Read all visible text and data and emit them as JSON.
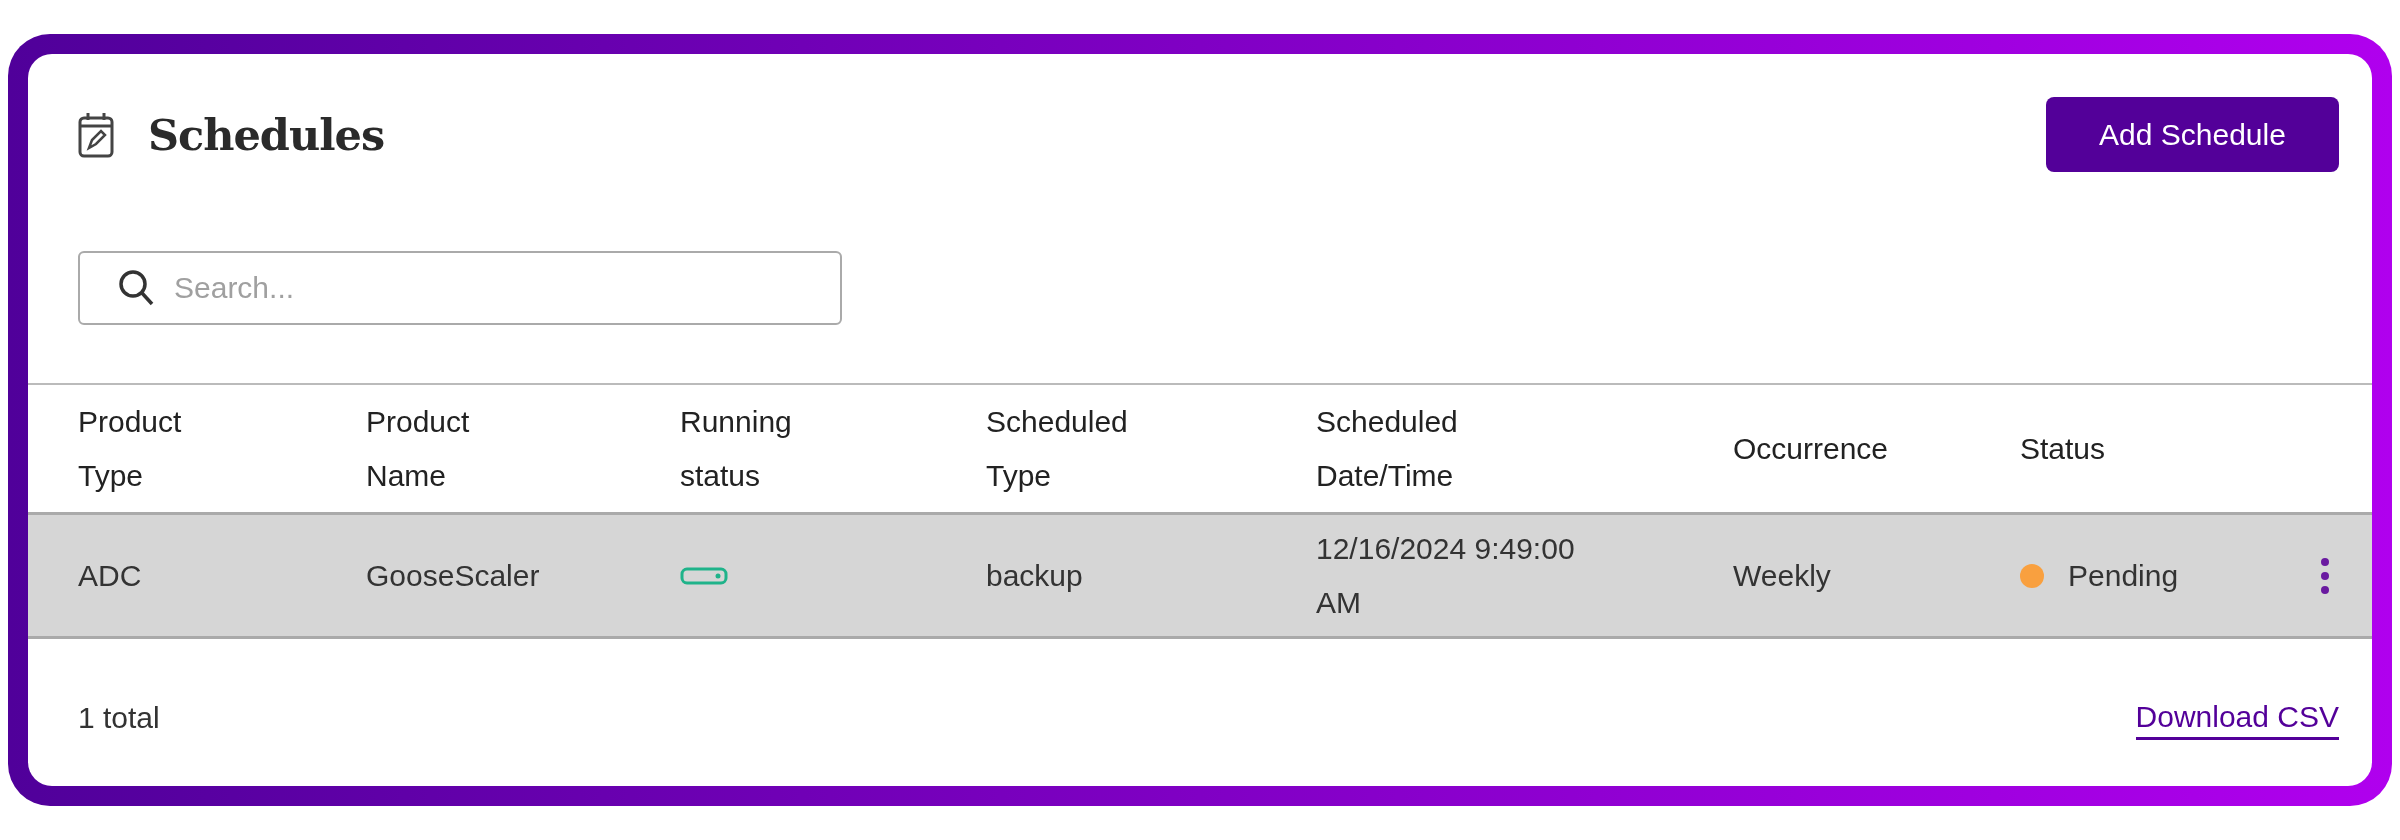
{
  "title": "Schedules",
  "add_button": "Add Schedule",
  "search": {
    "placeholder": "Search..."
  },
  "table": {
    "columns": [
      "Product Type",
      "Product Name",
      "Running status",
      "Scheduled Type",
      "Scheduled Date/Time",
      "Occurrence",
      "Status"
    ],
    "rows": [
      {
        "product_type": "ADC",
        "product_name": "GooseScaler",
        "running": true,
        "scheduled_type": "backup",
        "scheduled_datetime": "12/16/2024 9:49:00 AM",
        "occurrence": "Weekly",
        "status": "Pending",
        "color": "#f9a03f",
        "selected": true
      }
    ]
  },
  "footer": {
    "total": "1 total",
    "download": "Download CSV"
  }
}
